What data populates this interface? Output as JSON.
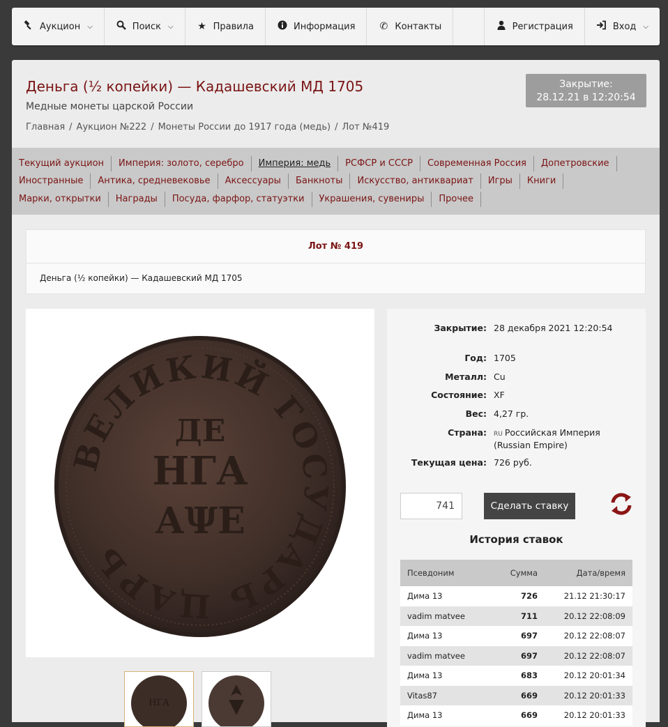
{
  "nav": {
    "items": [
      {
        "label": "Аукцион",
        "icon": "gavel-icon",
        "dropdown": true
      },
      {
        "label": "Поиск",
        "icon": "search-icon",
        "dropdown": true
      },
      {
        "label": "Правила",
        "icon": "star-icon",
        "dropdown": false
      },
      {
        "label": "Информация",
        "icon": "info-icon",
        "dropdown": false
      },
      {
        "label": "Контакты",
        "icon": "phone-icon",
        "dropdown": false
      }
    ],
    "register_label": "Регистрация",
    "login_label": "Вход"
  },
  "page": {
    "title": "Деньга (½ копейки) — Кадашевский МД 1705",
    "subtitle": "Медные монеты царской России",
    "breadcrumb": [
      "Главная",
      "Аукцион №222",
      "Монеты России до 1917 года (медь)",
      "Лот №419"
    ],
    "close_label": "Закрытие:",
    "close_value": "28.12.21 в 12:20:54"
  },
  "categories": [
    [
      "Текущий аукцион",
      "Империя: золото, серебро",
      "Империя: медь",
      "РСФСР и СССР",
      "Современная Россия",
      "Допетровские"
    ],
    [
      "Иностранные",
      "Антика, средневековье",
      "Аксессуары",
      "Банкноты",
      "Искусство, антиквариат",
      "Игры",
      "Книги"
    ],
    [
      "Марки, открытки",
      "Награды",
      "Посуда, фарфор, статуэтки",
      "Украшения, сувениры",
      "Прочее"
    ]
  ],
  "active_category": "Империя: медь",
  "lot": {
    "header": "Лот № 419",
    "description": "Деньга (½ копейки) — Кадашевский МД 1705"
  },
  "info": {
    "close_key": "Закрытие:",
    "close_val": "28 декабря 2021 12:20:54",
    "year_key": "Год:",
    "year_val": "1705",
    "metal_key": "Металл:",
    "metal_val": "Cu",
    "cond_key": "Состояние:",
    "cond_val": "XF",
    "weight_key": "Вес:",
    "weight_val": "4,27 гр.",
    "country_key": "Страна:",
    "country_flag": "RU",
    "country_val": "Российская Империя (Russian Empire)",
    "price_key": "Текущая цена:",
    "price_val": "726 руб."
  },
  "bid": {
    "value": "741",
    "button": "Сделать ставку"
  },
  "history": {
    "title": "История ставок",
    "headers": [
      "Псевдоним",
      "Сумма",
      "Дата/время"
    ],
    "rows": [
      [
        "Дима 13",
        "726",
        "21.12 21:30:17"
      ],
      [
        "vadim matvee",
        "711",
        "20.12 22:08:09"
      ],
      [
        "Дима 13",
        "697",
        "20.12 22:08:07"
      ],
      [
        "vadim matvee",
        "697",
        "20.12 22:08:07"
      ],
      [
        "Дима 13",
        "683",
        "20.12 20:01:34"
      ],
      [
        "Vitas87",
        "669",
        "20.12 20:01:33"
      ],
      [
        "Дима 13",
        "669",
        "20.12 20:01:33"
      ]
    ]
  },
  "coin_legend": {
    "center": [
      "ДЕ",
      "НГА",
      "АΨЕ"
    ],
    "ring": "ВЕЛИКИЙ ГОСУДАРЬ ЦАРЬ"
  }
}
